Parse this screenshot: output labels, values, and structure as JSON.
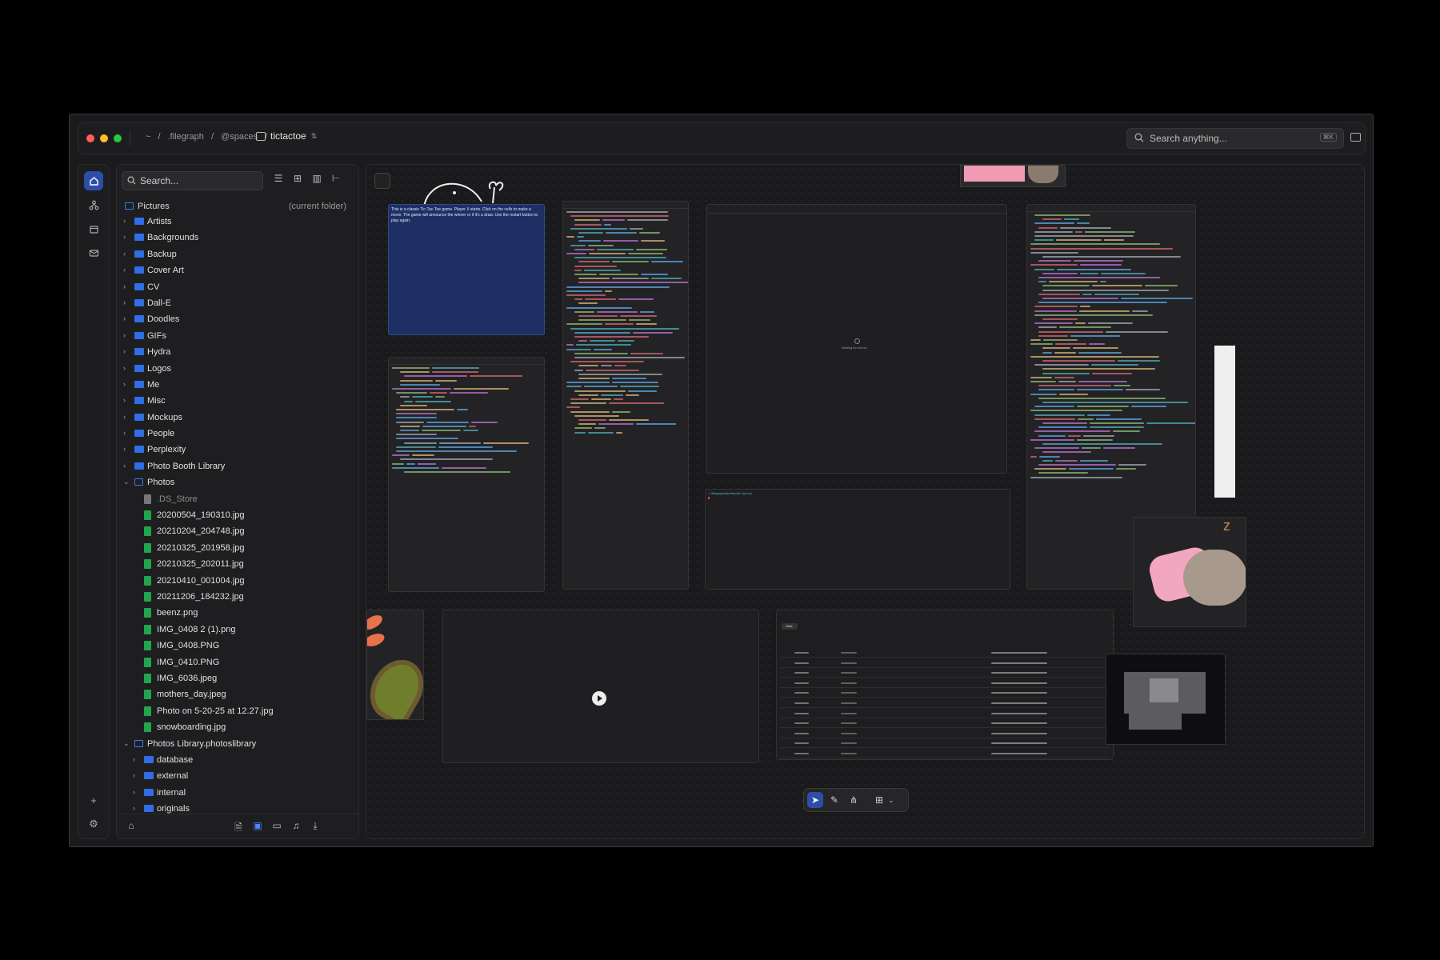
{
  "titlebar": {
    "breadcrumb": [
      "~",
      "/",
      ".filegraph",
      "/",
      "@spaces",
      "/"
    ],
    "space_name": "tictactoe",
    "search_placeholder": "Search anything...",
    "search_shortcut": "⌘K"
  },
  "panel": {
    "search_placeholder": "Search...",
    "root_label": "Pictures",
    "root_note": "(current folder)",
    "folders": [
      "Artists",
      "Backgrounds",
      "Backup",
      "Cover Art",
      "CV",
      "Dall-E",
      "Doodles",
      "GIFs",
      "Hydra",
      "Logos",
      "Me",
      "Misc",
      "Mockups",
      "People",
      "Perplexity",
      "Photo Booth Library"
    ],
    "open_folder": "Photos",
    "files": [
      ".DS_Store",
      "20200504_190310.jpg",
      "20210204_204748.jpg",
      "20210325_201958.jpg",
      "20210325_202011.jpg",
      "20210410_001004.jpg",
      "20211206_184232.jpg",
      "beenz.png",
      "IMG_0408 2 (1).png",
      "IMG_0408.PNG",
      "IMG_0410.PNG",
      "IMG_6036.jpeg",
      "mothers_day.jpeg",
      "Photo on 5-20-25 at 12.27.jpg",
      "snowboarding.jpg"
    ],
    "library_folder": "Photos Library.photoslibrary",
    "library_children": [
      "database",
      "external",
      "internal",
      "originals"
    ]
  },
  "canvas": {
    "note_text": "This is a classic Tic-Tac-Toe game. Player X starts. Click on the cells to make a move. The game will announce the winner or if it's a draw. Use the restart button to play again.",
    "browser_status": "Waiting for server...",
    "terminal_path": "~/.filegraph/sandbox/tic-tac-toe",
    "table_tab": "Data"
  },
  "colors": {
    "accent": "#2d4ea8",
    "folder": "#2f6ee5",
    "image_file": "#1fa64a"
  }
}
